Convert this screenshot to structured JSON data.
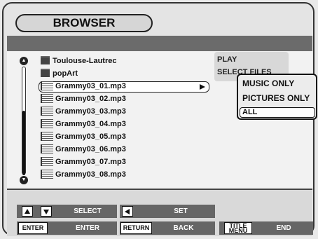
{
  "window": {
    "title": "BROWSER"
  },
  "list": {
    "items": [
      {
        "label": "Toulouse-Lautrec",
        "type": "folder"
      },
      {
        "label": "popArt",
        "type": "folder"
      },
      {
        "label": "Grammy03_01.mp3",
        "type": "music",
        "selected": true
      },
      {
        "label": "Grammy03_02.mp3",
        "type": "music"
      },
      {
        "label": "Grammy03_03.mp3",
        "type": "music"
      },
      {
        "label": "Grammy03_04.mp3",
        "type": "music"
      },
      {
        "label": "Grammy03_05.mp3",
        "type": "music"
      },
      {
        "label": "Grammy03_06.mp3",
        "type": "music"
      },
      {
        "label": "Grammy03_07.mp3",
        "type": "music"
      },
      {
        "label": "Grammy03_08.mp3",
        "type": "music"
      }
    ]
  },
  "menu": {
    "play": "PLAY",
    "select_files": "SELECT FILES"
  },
  "submenu": {
    "music_only": "MUSIC ONLY",
    "pictures_only": "PICTURES ONLY",
    "all": "ALL",
    "selected": "ALL"
  },
  "footer": {
    "select": "SELECT",
    "set": "SET",
    "enter_key": "ENTER",
    "enter": "ENTER",
    "return_key": "RETURN",
    "back": "BACK",
    "title_menu_key_line1": "TITLE",
    "title_menu_key_line2": "MENU",
    "end": "END"
  },
  "icons": [
    "scroll-up-icon",
    "scroll-down-icon",
    "folder-icon",
    "music-file-icon",
    "play-icon",
    "up-arrow-icon",
    "down-arrow-icon",
    "left-arrow-icon"
  ]
}
